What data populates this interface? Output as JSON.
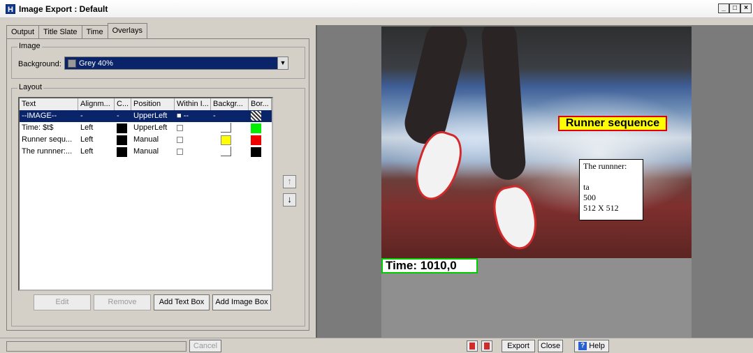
{
  "window": {
    "icon": "H",
    "title": "Image Export : Default",
    "controls": [
      "_",
      "□",
      "×"
    ]
  },
  "tabs": [
    "Output",
    "Title Slate",
    "Time",
    "Overlays"
  ],
  "image_group": {
    "legend": "Image",
    "background_label": "Background:",
    "background_value": "Grey 40%",
    "background_swatch_color": "#999999"
  },
  "layout_group": {
    "legend": "Layout",
    "columns": [
      "Text",
      "Alignm...",
      "C...",
      "Position",
      "Within I...",
      "Backgr...",
      "Bor..."
    ],
    "rows": [
      {
        "text": "--IMAGE--",
        "align": "-",
        "color": "-",
        "position": "UpperLeft",
        "within": "■ --",
        "background": "-",
        "border": "hatch"
      },
      {
        "text": "Time: $t$",
        "align": "Left",
        "color": "#000000",
        "position": "UpperLeft",
        "within": "",
        "background": "none",
        "border": "#00ee00"
      },
      {
        "text": "Runner sequ...",
        "align": "Left",
        "color": "#000000",
        "position": "Manual",
        "within": "",
        "background": "#ffff00",
        "border": "#ee0000"
      },
      {
        "text": "The runnner:...",
        "align": "Left",
        "color": "#000000",
        "position": "Manual",
        "within": "",
        "background": "none",
        "border": "#000000"
      }
    ],
    "move_up_icon": "arrow-up",
    "move_down_icon": "arrow-down",
    "buttons": {
      "edit": "Edit",
      "remove": "Remove",
      "add_text": "Add Text Box",
      "add_image": "Add Image Box"
    }
  },
  "preview": {
    "runner_label": "Runner sequence",
    "info_lines": [
      "The runnner:",
      "",
      "ta",
      "500",
      "512 X 512"
    ],
    "time_label": "Time: 1010,0"
  },
  "bottom": {
    "cancel": "Cancel",
    "export": "Export",
    "close": "Close",
    "help": "Help"
  }
}
